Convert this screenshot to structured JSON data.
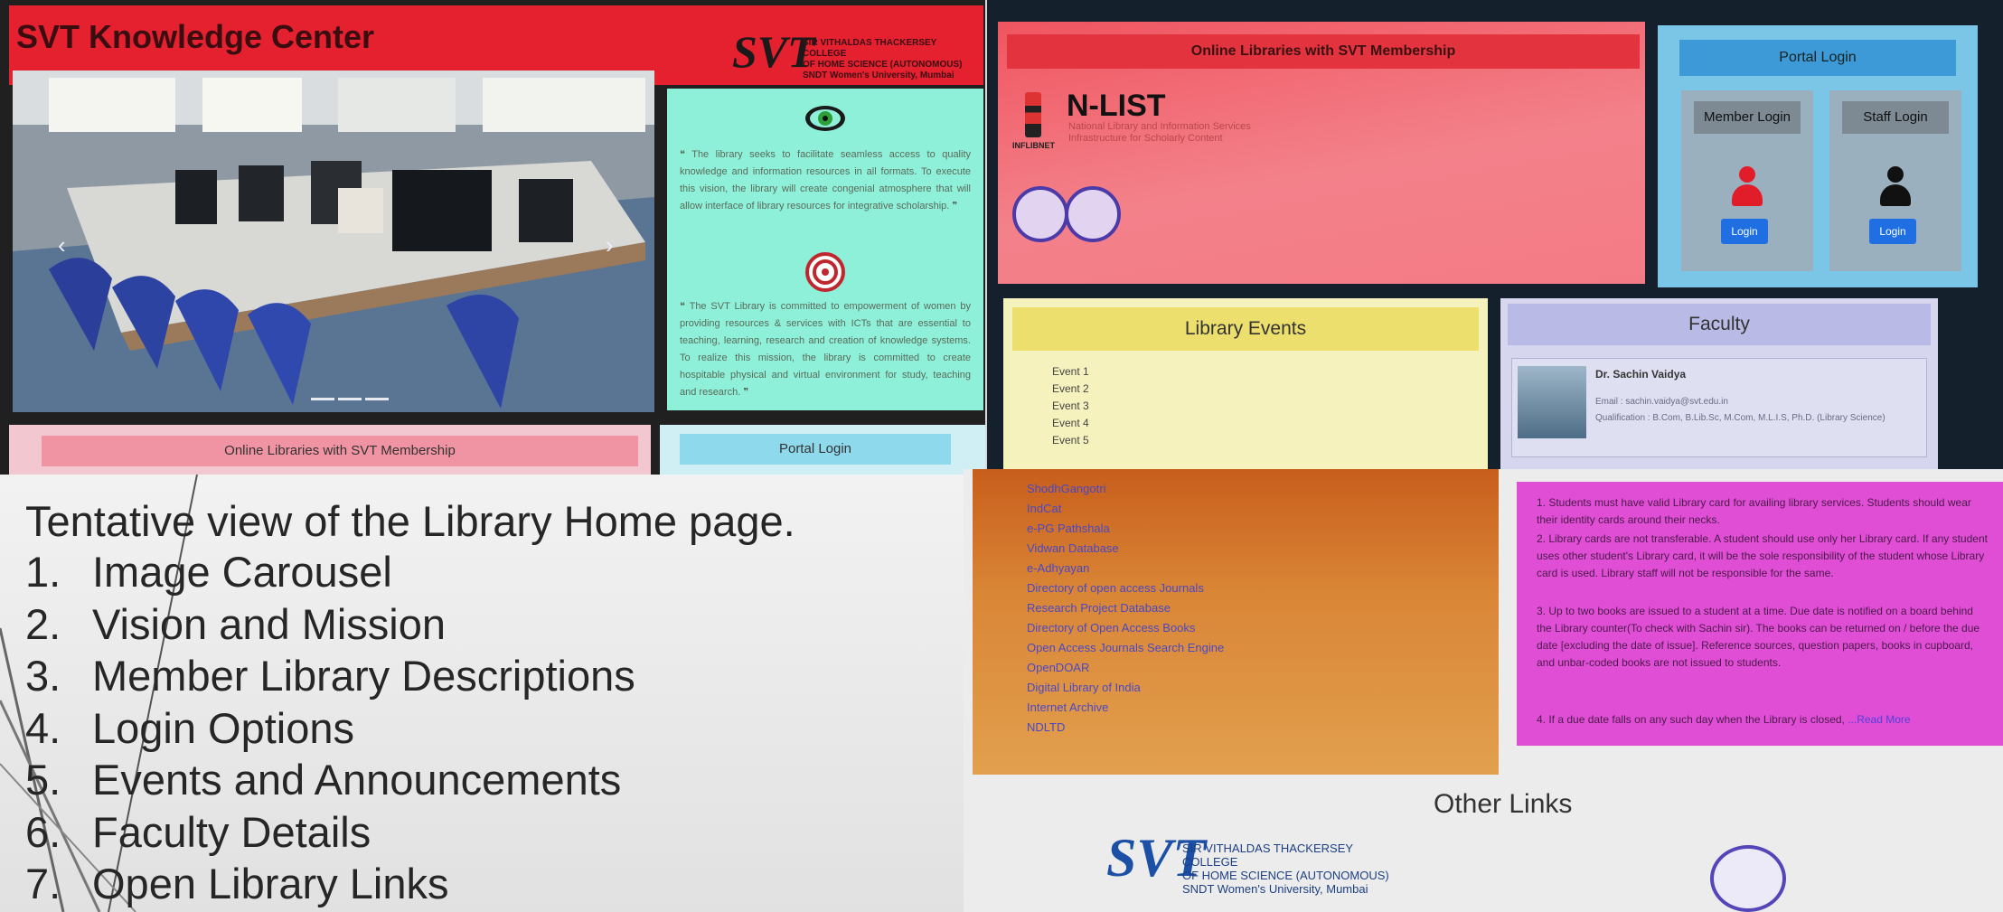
{
  "slide": {
    "heading": "Tentative view of the Library Home page.",
    "items": [
      {
        "num": "1.",
        "label": "Image Carousel"
      },
      {
        "num": "2.",
        "label": "Vision and Mission"
      },
      {
        "num": "3.",
        "label": "Member Library Descriptions"
      },
      {
        "num": "4.",
        "label": "Login Options"
      },
      {
        "num": "5.",
        "label": "Events and Announcements"
      },
      {
        "num": "6.",
        "label": "Faculty Details"
      },
      {
        "num": "7.",
        "label": "Open Library Links"
      }
    ]
  },
  "shot1": {
    "title": "SVT Knowledge Center",
    "logo_mark": "SVT",
    "logo_lines": [
      "SIR VITHALDAS THACKERSEY COLLEGE",
      "OF HOME SCIENCE (AUTONOMOUS)",
      "SNDT Women's University, Mumbai"
    ],
    "carousel_prev": "‹",
    "carousel_next": "›",
    "vision_icon": "eye-icon",
    "vision_text": "The library seeks to facilitate seamless access to quality knowledge and information resources in all formats. To execute this vision, the library will create congenial atmosphere that will allow interface of library resources for integrative scholarship.",
    "mission_icon": "target-icon",
    "mission_text": "The SVT Library is committed to empowerment of women by providing resources & services with ICTs that are essential to teaching, learning, research and creation of knowledge systems. To realize this mission, the library is committed to create hospitable physical and virtual environment for study, teaching and research.",
    "online_libraries_label": "Online Libraries with SVT Membership",
    "portal_login_label": "Portal Login"
  },
  "shot2": {
    "online_libraries_heading": "Online Libraries with SVT Membership",
    "nlist_name": "N-LIST",
    "nlist_sub1": "National Library and Information Services",
    "nlist_sub2": "Infrastructure for Scholarly Content",
    "nlist_sub3": "",
    "inflibnet_label": "INFLIBNET",
    "portal_login_heading": "Portal Login",
    "member_login_label": "Member Login",
    "staff_login_label": "Staff Login",
    "login_button": "Login",
    "events_heading": "Library Events",
    "events": [
      "Event 1",
      "Event 2",
      "Event 3",
      "Event 4",
      "Event 5"
    ],
    "faculty_heading": "Faculty",
    "faculty_name": "Dr. Sachin Vaidya",
    "faculty_email": "Email : sachin.vaidya@svt.edu.in",
    "faculty_qualification": "Qualification : B.Com, B.Lib.Sc, M.Com, M.L.I.S, Ph.D. (Library Science)",
    "colors": {
      "member_icon": "#e11d2a",
      "staff_icon": "#111111"
    }
  },
  "shot3": {
    "links": [
      "ShodhGangotri",
      "IndCat",
      "e-PG Pathshala",
      "Vidwan Database",
      "e-Adhyayan",
      "Directory of open access Journals",
      "Research Project Database",
      "Directory of Open Access Books",
      "Open Access Journals Search Engine",
      "OpenDOAR",
      "Digital Library of India",
      "Internet Archive",
      "NDLTD"
    ],
    "rules": [
      "1. Students must have valid Library card for availing library services. Students should wear their identity cards around their necks.",
      "2. Library cards are not transferable. A student should use only her Library card. If any student uses other student's Library card, it will be the sole responsibility of the student whose Library card is used. Library staff will not be responsible for the same.",
      "3. Up to two books are issued to a student at a time. Due date is notified on a board behind the Library counter(To check with Sachin sir). The books can be returned on / before the due date [excluding the date of issue]. Reference sources, question papers, books in cupboard, and unbar-coded books are not issued to students.",
      "4. If a due date falls on any such day when the Library is closed,"
    ],
    "read_more": "...Read More",
    "other_links_heading": "Other Links",
    "logo_mark": "SVT",
    "logo_lines": [
      "SIR VITHALDAS THACKERSEY COLLEGE",
      "OF HOME SCIENCE (AUTONOMOUS)",
      "SNDT Women's University, Mumbai"
    ],
    "browser_icons": [
      "star-icon",
      "extensions-icon",
      "profile-icon"
    ]
  }
}
